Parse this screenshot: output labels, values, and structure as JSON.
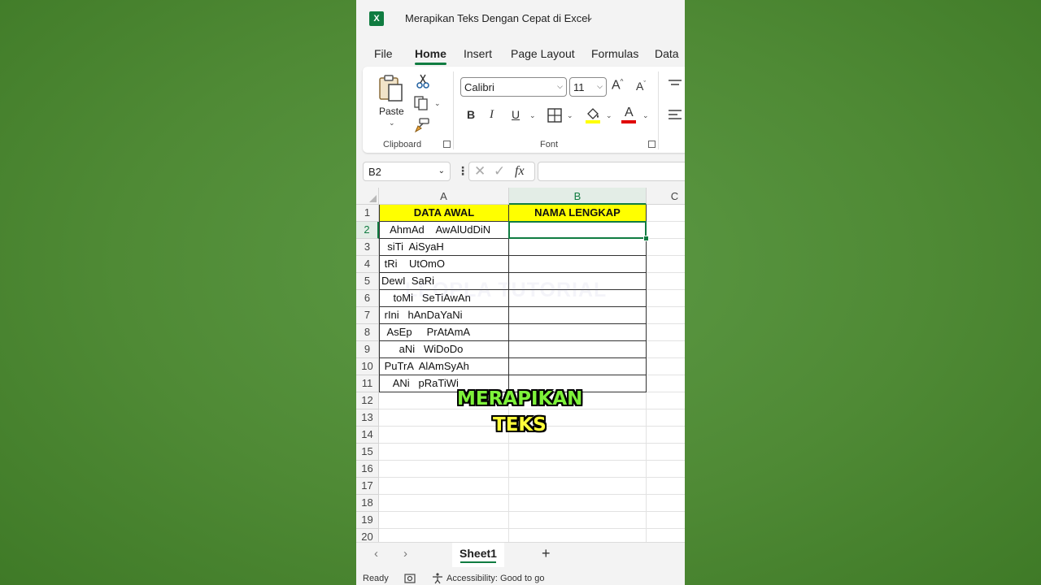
{
  "app": {
    "title": "Merapikan Teks Dengan Cepat di Excel",
    "logo_letter": "X",
    "brand_color": "#107c41"
  },
  "tabs": [
    "File",
    "Home",
    "Insert",
    "Page Layout",
    "Formulas",
    "Data"
  ],
  "active_tab": "Home",
  "ribbon": {
    "clipboard": {
      "paste_label": "Paste",
      "group_label": "Clipboard",
      "icons": [
        "paste-icon",
        "cut-icon",
        "copy-icon",
        "format-painter-icon"
      ]
    },
    "font": {
      "font_name": "Calibri",
      "font_size": "11",
      "group_label": "Font",
      "grow_label": "A",
      "shrink_label": "A",
      "bold_label": "B",
      "italic_label": "I",
      "underline_label": "U",
      "font_color_label": "A",
      "highlight_color": "#ffff00",
      "font_color": "#e00000"
    }
  },
  "formula_bar": {
    "name_box": "B2",
    "fx_label": "fx",
    "value": ""
  },
  "grid": {
    "columns": [
      "A",
      "B",
      "C"
    ],
    "selected_column": "B",
    "selected_row": "2",
    "rows": [
      "1",
      "2",
      "3",
      "4",
      "5",
      "6",
      "7",
      "8",
      "9",
      "10",
      "11",
      "12",
      "13",
      "14",
      "15",
      "16",
      "17",
      "18",
      "19",
      "20"
    ],
    "header": {
      "a": "DATA AWAL",
      "b": "NAMA LENGKAP"
    },
    "data_a": [
      "   AhmAd    AwAlUdDiN",
      "  siTi  AiSyaH",
      " tRi    UtOmO",
      "DewI  SaRi",
      "    toMi   SeTiAwAn",
      " rIni   hAnDaYaNi",
      "  AsEp     PrAtAmA",
      "      aNi   WiDoDo",
      " PuTrA  AlAmSyAh",
      "    ANi   pRaTiWi"
    ],
    "watermark": "LEOPLA TUTORIAL"
  },
  "sheets": {
    "active": "Sheet1",
    "add_label": "+"
  },
  "status": {
    "ready": "Ready",
    "accessibility": "Accessibility: Good to go"
  },
  "caption": {
    "line1": "MERAPIKAN",
    "line2": "TEKS",
    "color1": "#7ef23a",
    "color2": "#ffff3a"
  }
}
